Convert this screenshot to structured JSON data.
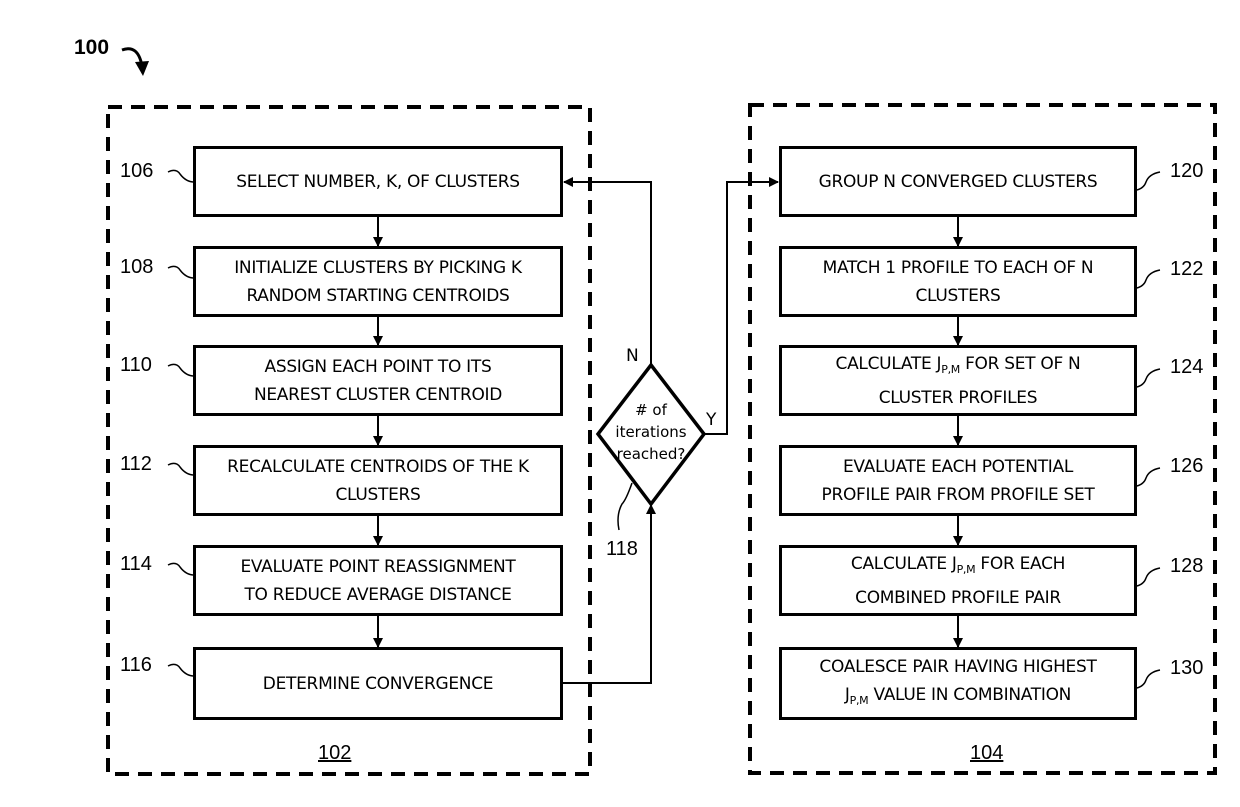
{
  "figure": {
    "ref": "100"
  },
  "regions": {
    "left": {
      "ref": "102"
    },
    "right": {
      "ref": "104"
    }
  },
  "left_steps": [
    {
      "ref": "106",
      "line1": "SELECT NUMBER, K, OF CLUSTERS",
      "line2": ""
    },
    {
      "ref": "108",
      "line1": "INITIALIZE CLUSTERS BY PICKING K",
      "line2": "RANDOM STARTING CENTROIDS"
    },
    {
      "ref": "110",
      "line1": "ASSIGN EACH POINT TO ITS",
      "line2": "NEAREST CLUSTER CENTROID"
    },
    {
      "ref": "112",
      "line1": "RECALCULATE CENTROIDS OF THE K",
      "line2": "CLUSTERS"
    },
    {
      "ref": "114",
      "line1": "EVALUATE POINT REASSIGNMENT",
      "line2": "TO REDUCE AVERAGE DISTANCE"
    },
    {
      "ref": "116",
      "line1": "DETERMINE CONVERGENCE",
      "line2": ""
    }
  ],
  "decision": {
    "ref": "118",
    "line1": "# of",
    "line2": "iterations",
    "line3": "reached?",
    "no_label": "N",
    "yes_label": "Y"
  },
  "right_steps": [
    {
      "ref": "120",
      "line1": "GROUP N CONVERGED CLUSTERS",
      "line2": ""
    },
    {
      "ref": "122",
      "line1": "MATCH 1 PROFILE TO EACH OF N",
      "line2": "CLUSTERS"
    },
    {
      "ref": "124",
      "l1_pre": "CALCULATE J",
      "l1_sub": "P,M",
      "l1_post": " FOR SET OF N",
      "line2": "CLUSTER PROFILES"
    },
    {
      "ref": "126",
      "line1": "EVALUATE EACH POTENTIAL",
      "line2": "PROFILE PAIR FROM PROFILE SET"
    },
    {
      "ref": "128",
      "l1_pre": "CALCULATE J",
      "l1_sub": "P,M",
      "l1_post": " FOR EACH",
      "line2": "COMBINED PROFILE PAIR"
    },
    {
      "ref": "130",
      "line1": "COALESCE PAIR HAVING HIGHEST",
      "l2_pre": "J",
      "l2_sub": "P,M",
      "l2_post": " VALUE IN COMBINATION"
    }
  ]
}
